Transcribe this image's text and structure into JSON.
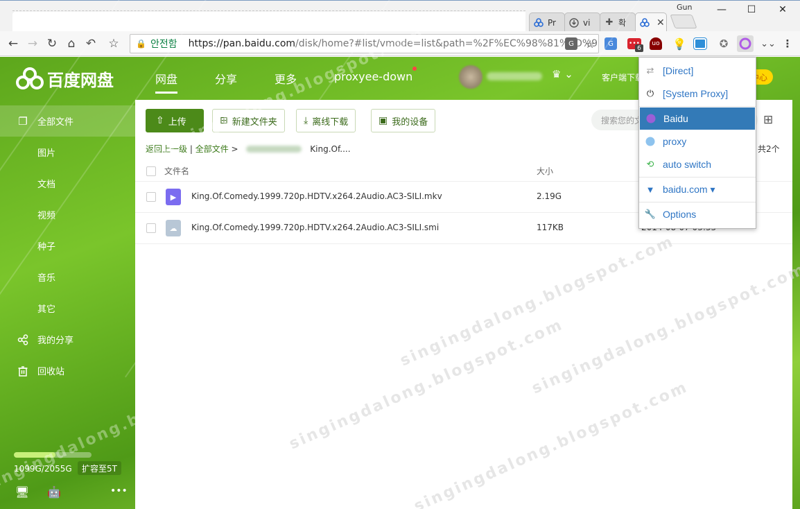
{
  "browser": {
    "profile_name": "Gun",
    "tabs": [
      {
        "label": "Pr",
        "icon": "baidu-paw-icon"
      },
      {
        "label": "vi",
        "icon": "download-circle-icon"
      },
      {
        "label": "확",
        "icon": "puzzle-icon"
      },
      {
        "label": "",
        "icon": "baidu-paw-icon",
        "active": true
      }
    ],
    "security_label": "안전함",
    "url_host": "https://pan.baidu.com",
    "url_rest": "/disk/home?#list/vmode=list&path=%2F%EC%98%81%ED%9...",
    "extension_badge": "6"
  },
  "app": {
    "logo_text": "百度网盘",
    "nav": [
      "网盘",
      "分享",
      "更多",
      "proxyee-down"
    ],
    "client_download": "客户端下载",
    "member_center": "员中心"
  },
  "sidebar": {
    "items": [
      {
        "label": "全部文件",
        "icon": "all-files-icon",
        "active": true
      },
      {
        "label": "图片"
      },
      {
        "label": "文档"
      },
      {
        "label": "视频"
      },
      {
        "label": "种子"
      },
      {
        "label": "音乐"
      },
      {
        "label": "其它"
      },
      {
        "label": "我的分享",
        "icon": "share-icon"
      },
      {
        "label": "回收站",
        "icon": "recycle-bin-icon"
      }
    ],
    "quota_text": "1099G/2055G",
    "quota_fraction": 0.535,
    "expand_label": "扩容至5T"
  },
  "toolbar": {
    "upload": "上传",
    "new_folder": "新建文件夹",
    "offline_download": "离线下载",
    "my_devices": "我的设备",
    "search_placeholder": "搜索您的文件"
  },
  "breadcrumb": {
    "back": "返回上一级",
    "all_files": "全部文件",
    "current": "King.Of....",
    "count": "共2个"
  },
  "table": {
    "headers": {
      "name": "文件名",
      "size": "大小"
    },
    "rows": [
      {
        "name": "King.Of.Comedy.1999.720p.HDTV.x264.2Audio.AC3-SILI.mkv",
        "size": "2.19G",
        "date": "",
        "type": "video"
      },
      {
        "name": "King.Of.Comedy.1999.720p.HDTV.x264.2Audio.AC3-SILI.smi",
        "size": "117KB",
        "date": "2014-08-07 03:33",
        "type": "other"
      }
    ]
  },
  "proxy_menu": {
    "items": [
      {
        "label": "[Direct]",
        "icon": "direct-arrows-icon"
      },
      {
        "label": "[System Proxy]",
        "icon": "power-icon"
      },
      {
        "label": "Baidu",
        "icon": "globe-icon",
        "selected": true
      },
      {
        "label": "proxy",
        "icon": "globe-icon"
      },
      {
        "label": "auto switch",
        "icon": "auto-switch-icon"
      },
      {
        "label": "baidu.com ▾",
        "icon": "filter-icon"
      },
      {
        "label": "Options",
        "icon": "wrench-icon"
      }
    ]
  },
  "watermark": "singingdalong.blogspot.com",
  "colors": {
    "brand_green": "#4c8a19",
    "popup_selected": "#337ab7",
    "link_blue": "#2e75c4"
  }
}
